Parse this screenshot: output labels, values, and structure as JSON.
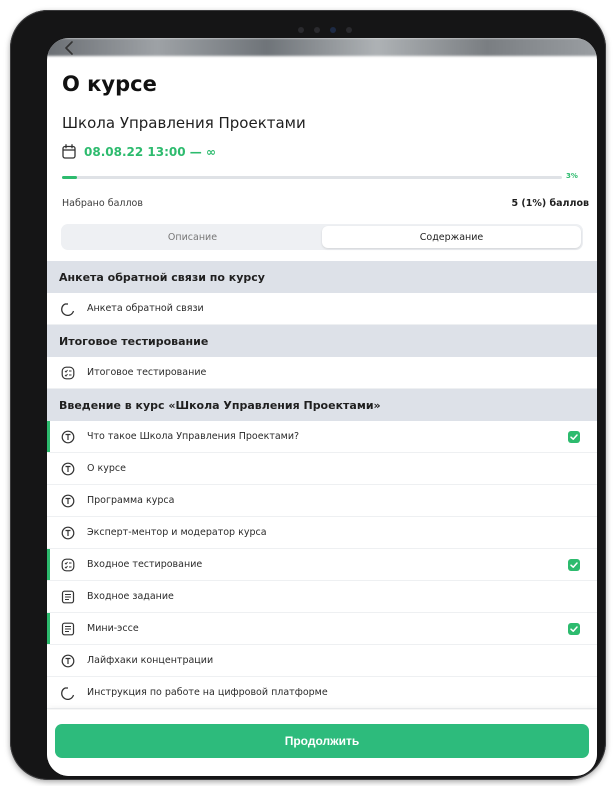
{
  "header": {
    "back_icon": "chevron-left-icon",
    "title": "О курсе"
  },
  "course": {
    "name": "Школа Управления Проектами",
    "date_icon": "calendar-icon",
    "date": "08.08.22 13:00 — ∞"
  },
  "progress": {
    "percent_label": "3%",
    "fraction": 0.03,
    "color": "#2dbb6e"
  },
  "score": {
    "label": "Набрано баллов",
    "value": "5 (1%) баллов"
  },
  "tabs": [
    {
      "label": "Описание",
      "active": false
    },
    {
      "label": "Содержание",
      "active": true
    }
  ],
  "sections": [
    {
      "title": "Анкета обратной связи по курсу",
      "items": [
        {
          "label": "Анкета обратной связи",
          "icon": "survey-icon",
          "done": false
        }
      ]
    },
    {
      "title": "Итоговое тестирование",
      "items": [
        {
          "label": "Итоговое тестирование",
          "icon": "test-icon",
          "done": false
        }
      ]
    },
    {
      "title": "Введение в курс «Школа Управления Проектами»",
      "items": [
        {
          "label": "Что такое Школа Управления Проектами?",
          "icon": "text-lesson-icon",
          "done": true
        },
        {
          "label": "О курсе",
          "icon": "text-lesson-icon",
          "done": false
        },
        {
          "label": "Программа курса",
          "icon": "text-lesson-icon",
          "done": false
        },
        {
          "label": "Эксперт-ментор и модератор курса",
          "icon": "text-lesson-icon",
          "done": false
        },
        {
          "label": "Входное тестирование",
          "icon": "test-icon",
          "done": true
        },
        {
          "label": "Входное задание",
          "icon": "assignment-icon",
          "done": false
        },
        {
          "label": "Мини-эссе",
          "icon": "assignment-icon",
          "done": true
        },
        {
          "label": "Лайфхаки концентрации",
          "icon": "text-lesson-icon",
          "done": false
        },
        {
          "label": "Инструкция по работе на цифровой платформе",
          "icon": "survey-icon",
          "done": false
        }
      ]
    }
  ],
  "footer": {
    "continue_label": "Продолжить"
  },
  "colors": {
    "accent": "#2dbb6e",
    "button": "#2dbb7c",
    "section_bg": "#dde1e8"
  }
}
